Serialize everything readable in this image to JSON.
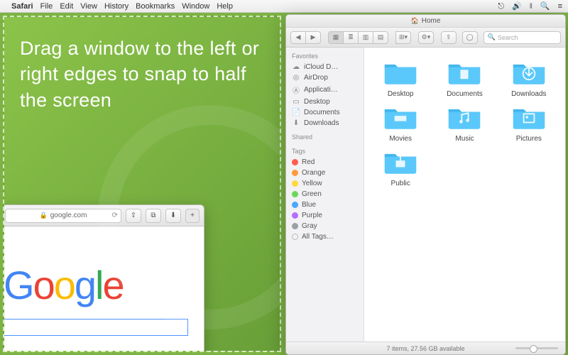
{
  "menubar": {
    "app": "Safari",
    "items": [
      "File",
      "Edit",
      "View",
      "History",
      "Bookmarks",
      "Window",
      "Help"
    ]
  },
  "promo": {
    "text": "Drag a window to the left or right edges to snap to half the screen"
  },
  "safari": {
    "url_host": "google.com",
    "page_logo_letters": [
      "G",
      "o",
      "o",
      "g",
      "l",
      "e"
    ]
  },
  "finder": {
    "title": "Home",
    "search_placeholder": "Search",
    "sidebar": {
      "favorites_label": "Favorites",
      "favorites": [
        {
          "icon": "cloud",
          "label": "iCloud D…"
        },
        {
          "icon": "airdrop",
          "label": "AirDrop"
        },
        {
          "icon": "apps",
          "label": "Applicati…"
        },
        {
          "icon": "desktop",
          "label": "Desktop"
        },
        {
          "icon": "doc",
          "label": "Documents"
        },
        {
          "icon": "down",
          "label": "Downloads"
        }
      ],
      "shared_label": "Shared",
      "tags_label": "Tags",
      "tags": [
        {
          "color": "#ff5b50",
          "label": "Red"
        },
        {
          "color": "#ff9a3c",
          "label": "Orange"
        },
        {
          "color": "#ffd93c",
          "label": "Yellow"
        },
        {
          "color": "#6ed65e",
          "label": "Green"
        },
        {
          "color": "#4aa7ff",
          "label": "Blue"
        },
        {
          "color": "#b56dff",
          "label": "Purple"
        },
        {
          "color": "#9aa0a6",
          "label": "Gray"
        },
        {
          "color": "",
          "label": "All Tags…"
        }
      ]
    },
    "folders": [
      {
        "name": "Desktop",
        "glyph": ""
      },
      {
        "name": "Documents",
        "glyph": "doc"
      },
      {
        "name": "Downloads",
        "glyph": "down"
      },
      {
        "name": "Movies",
        "glyph": "movie"
      },
      {
        "name": "Music",
        "glyph": "music"
      },
      {
        "name": "Pictures",
        "glyph": "pic"
      },
      {
        "name": "Public",
        "glyph": "public"
      }
    ],
    "status": "7 items, 27.56 GB available"
  }
}
